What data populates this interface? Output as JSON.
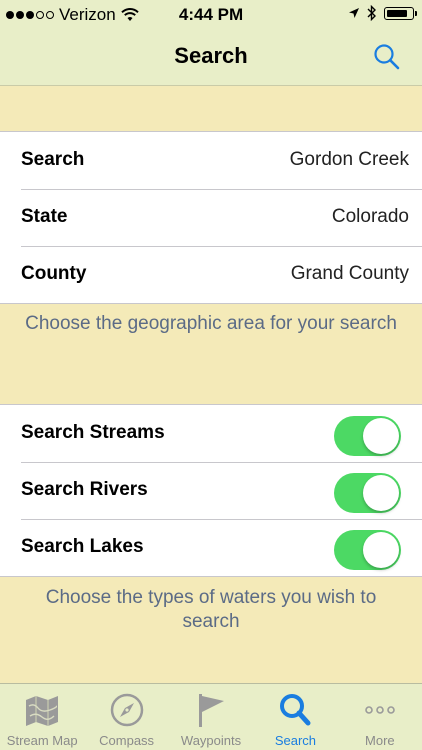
{
  "status": {
    "carrier": "Verizon",
    "time": "4:44 PM",
    "signal_full": 3,
    "signal_total": 5,
    "battery_level": 0.85
  },
  "nav": {
    "title": "Search"
  },
  "location": {
    "rows": [
      {
        "label": "Search",
        "value": "Gordon Creek"
      },
      {
        "label": "State",
        "value": "Colorado"
      },
      {
        "label": "County",
        "value": "Grand County"
      }
    ],
    "footer": "Choose the geographic area for your search"
  },
  "waters": {
    "rows": [
      {
        "label": "Search Streams",
        "on": true
      },
      {
        "label": "Search Rivers",
        "on": true
      },
      {
        "label": "Search Lakes",
        "on": true
      }
    ],
    "footer": "Choose the types of waters you wish to search"
  },
  "tabs": [
    {
      "label": "Stream Map",
      "icon": "map-icon",
      "active": false
    },
    {
      "label": "Compass",
      "icon": "compass-icon",
      "active": false
    },
    {
      "label": "Waypoints",
      "icon": "flag-icon",
      "active": false
    },
    {
      "label": "Search",
      "icon": "search-icon",
      "active": true
    },
    {
      "label": "More",
      "icon": "more-icon",
      "active": false
    }
  ],
  "colors": {
    "accent": "#1a7de0",
    "toggle_on": "#4cd964",
    "background": "#f4eab8",
    "bars": "#e8eec8",
    "footer_text": "#5b6b86"
  }
}
